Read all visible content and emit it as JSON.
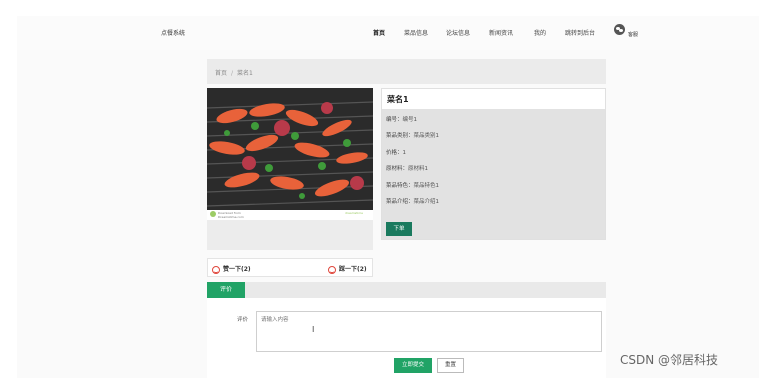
{
  "header": {
    "logo": "点餐系统",
    "nav": [
      "首页",
      "菜品信息",
      "论坛信息",
      "新闻资讯",
      "我的",
      "跳转到后台"
    ],
    "service_label": "客服"
  },
  "breadcrumb": {
    "home": "首页",
    "sep": "/",
    "current": "菜名1"
  },
  "image": {
    "strip_line1": "Download from",
    "strip_line2": "Dreamstime.com",
    "strip_right": "dreamstime"
  },
  "detail": {
    "title": "菜名1",
    "rows": [
      {
        "key": "编号：",
        "value": "编号1"
      },
      {
        "key": "菜品类别：",
        "value": "菜品类别1"
      },
      {
        "key": "价格：",
        "value": "1"
      },
      {
        "key": "原材料：",
        "value": "原材料1"
      },
      {
        "key": "菜品特色：",
        "value": "菜品特色1"
      },
      {
        "key": "菜品介绍：",
        "value": "菜品介绍1"
      }
    ],
    "order_label": "下单"
  },
  "votes": {
    "up": "赞一下(2)",
    "down": "踩一下(2)"
  },
  "comments": {
    "tab": "评价",
    "label": "评价",
    "placeholder": "请输入内容",
    "submit": "立即提交",
    "reset": "重置"
  },
  "watermark": "CSDN @邻居科技",
  "colors": {
    "accent": "#21a366",
    "order_button": "#1a7a5e",
    "vote_icon": "#e0463b"
  }
}
